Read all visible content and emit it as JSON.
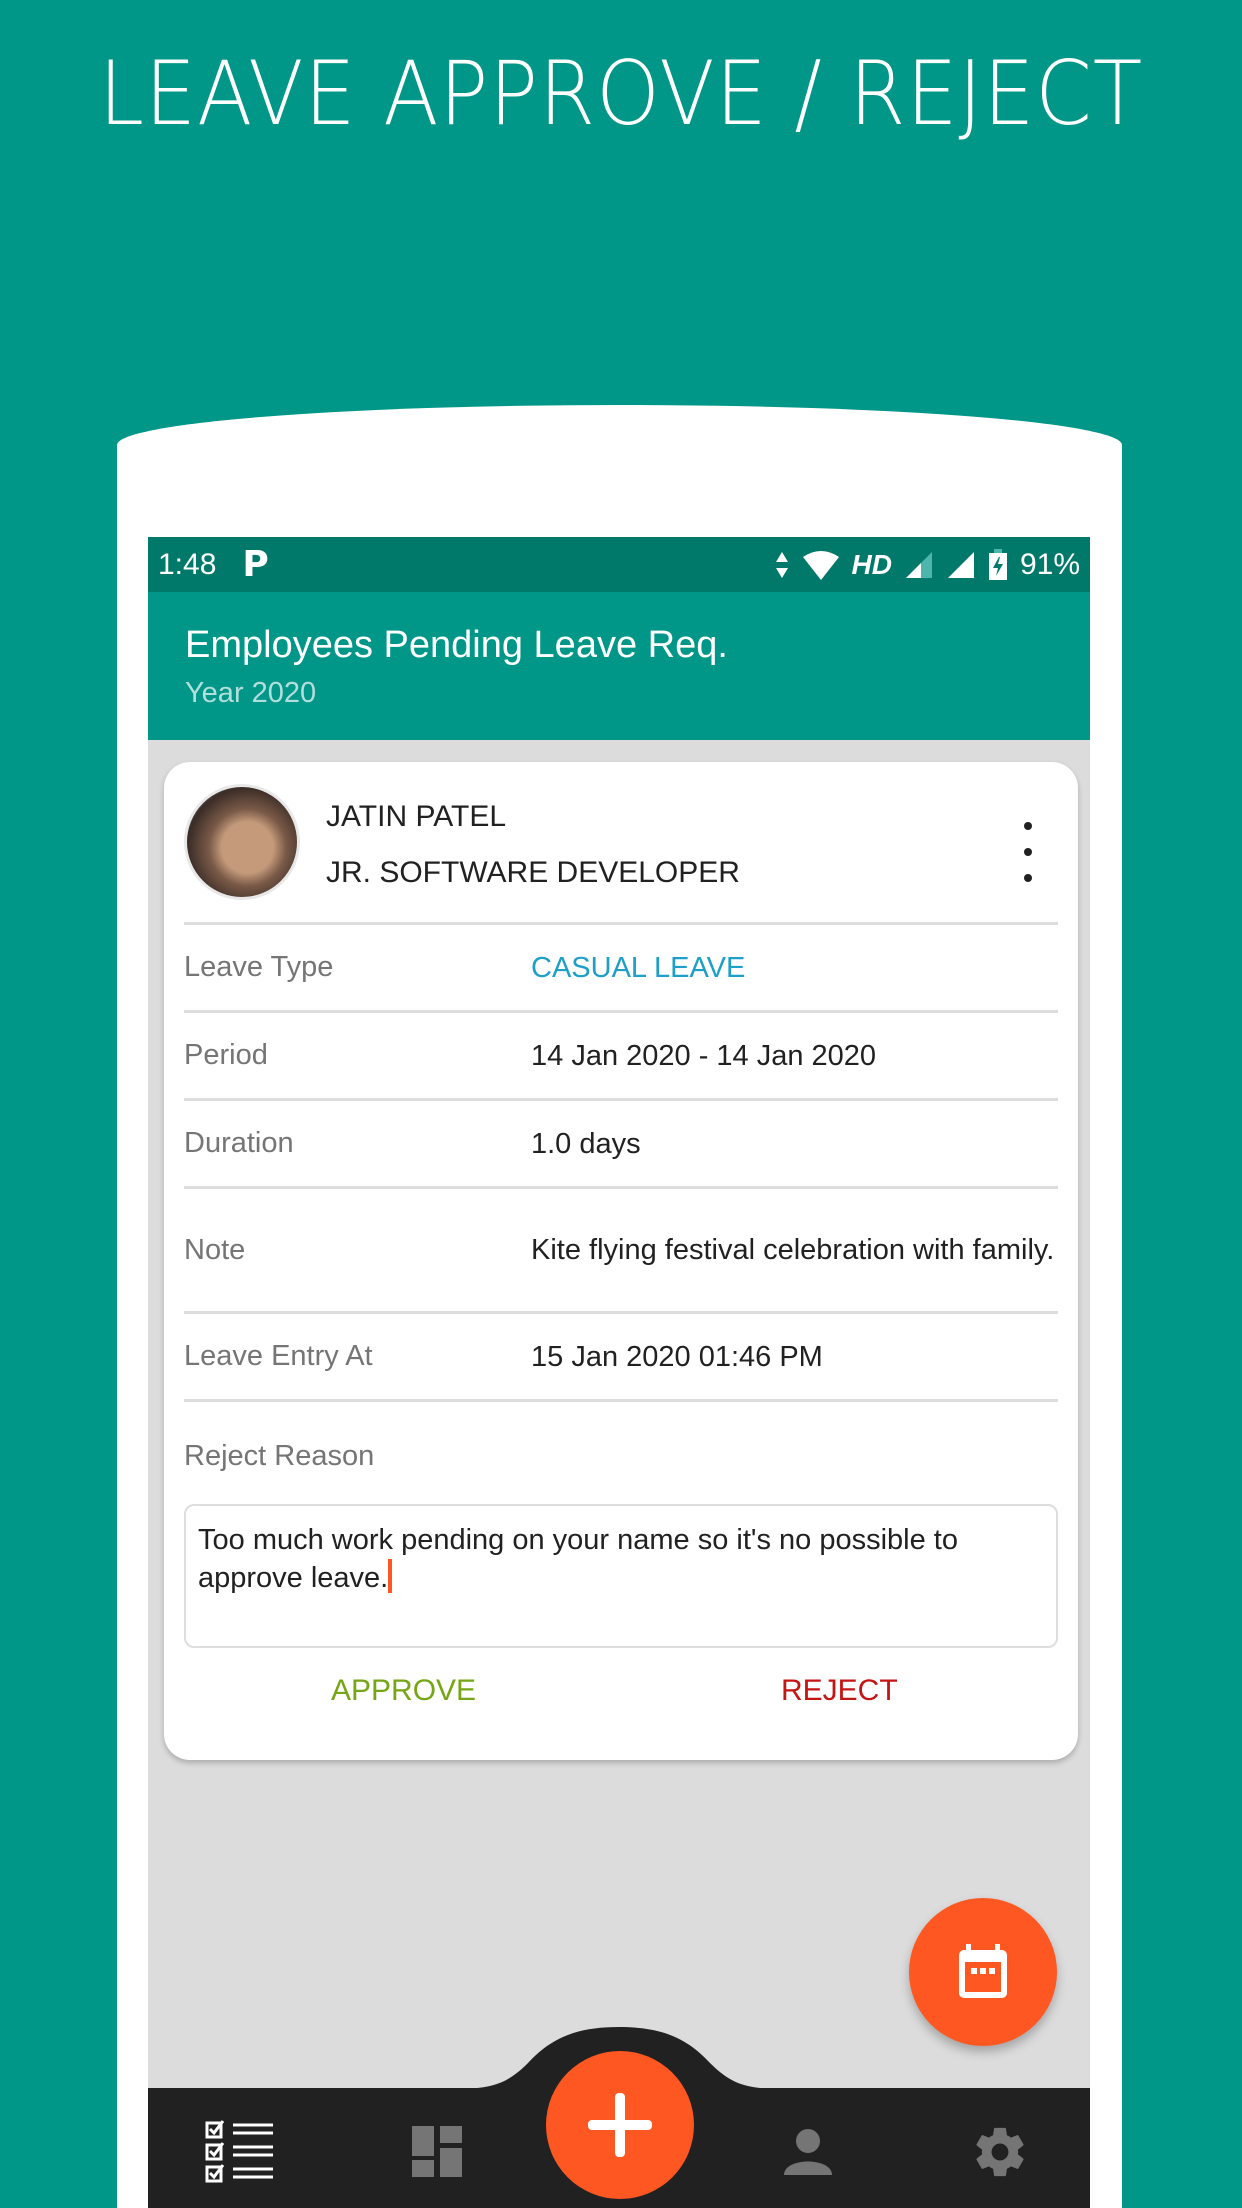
{
  "promo": {
    "title": "LEAVE APPROVE / REJECT"
  },
  "status_bar": {
    "time": "1:48",
    "notification_icon": "p-icon",
    "network_label": "HD",
    "battery_percent": "91%",
    "icons": [
      "data-arrows-icon",
      "wifi-icon",
      "signal-icon",
      "signal-icon",
      "battery-charging-icon"
    ]
  },
  "app_bar": {
    "title": "Employees Pending Leave Req.",
    "subtitle": "Year 2020"
  },
  "leave_card": {
    "employee_name": "JATIN PATEL",
    "employee_role": "JR. SOFTWARE DEVELOPER",
    "rows": [
      {
        "label": "Leave Type",
        "value": "CASUAL LEAVE"
      },
      {
        "label": "Period",
        "value": "14 Jan 2020 - 14 Jan 2020"
      },
      {
        "label": "Duration",
        "value": "1.0 days"
      },
      {
        "label": "Note",
        "value": "Kite flying festival celebration with family."
      },
      {
        "label": "Leave Entry At",
        "value": "15 Jan 2020 01:46 PM"
      }
    ],
    "reject_reason_label": "Reject Reason",
    "reject_reason_value": "Too much work pending on your name so it's no possible to approve leave.",
    "approve_label": "APPROVE",
    "reject_label": "REJECT"
  },
  "bottom_nav": {
    "items": [
      {
        "icon": "checklist-icon",
        "active": true
      },
      {
        "icon": "dashboard-icon",
        "active": false
      },
      {
        "icon": "add-icon",
        "active": false
      },
      {
        "icon": "person-icon",
        "active": false
      },
      {
        "icon": "settings-icon",
        "active": false
      }
    ]
  },
  "fab": {
    "calendar_icon": "calendar-icon",
    "add_icon": "add-icon"
  },
  "colors": {
    "background": "#009688",
    "status_bar": "#00796B",
    "accent": "#FF5722",
    "link": "#1E9FC7",
    "approve": "#76A515",
    "reject": "#C41515",
    "nav_bg": "#212121"
  }
}
